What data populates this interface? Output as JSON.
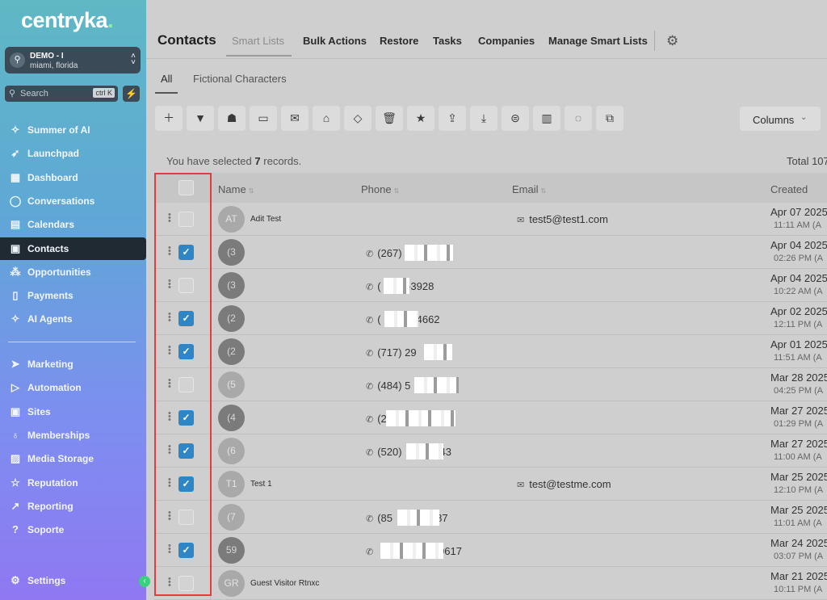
{
  "app": {
    "logo": "centryka",
    "logo_dot": "."
  },
  "account": {
    "name": "DEMO - I",
    "location": "miami, florida"
  },
  "search": {
    "placeholder": "Search",
    "shortcut": "ctrl K"
  },
  "sidebar": {
    "items": [
      {
        "label": "Summer of AI",
        "icon": "sparkle-icon"
      },
      {
        "label": "Launchpad",
        "icon": "rocket-icon"
      },
      {
        "label": "Dashboard",
        "icon": "grid-icon"
      },
      {
        "label": "Conversations",
        "icon": "chat-icon"
      },
      {
        "label": "Calendars",
        "icon": "calendar-icon"
      },
      {
        "label": "Contacts",
        "icon": "contacts-icon",
        "active": true
      },
      {
        "label": "Opportunities",
        "icon": "network-icon"
      },
      {
        "label": "Payments",
        "icon": "receipt-icon"
      },
      {
        "label": "AI Agents",
        "icon": "sparkle-icon"
      }
    ],
    "items2": [
      {
        "label": "Marketing",
        "icon": "send-icon"
      },
      {
        "label": "Automation",
        "icon": "play-icon"
      },
      {
        "label": "Sites",
        "icon": "browser-icon"
      },
      {
        "label": "Memberships",
        "icon": "badge-icon"
      },
      {
        "label": "Media Storage",
        "icon": "image-icon"
      },
      {
        "label": "Reputation",
        "icon": "star-icon"
      },
      {
        "label": "Reporting",
        "icon": "chart-icon"
      },
      {
        "label": "Soporte",
        "icon": "help-icon"
      }
    ],
    "settings": "Settings"
  },
  "header": {
    "title": "Contacts",
    "tabs": [
      "Smart Lists",
      "Bulk Actions",
      "Restore",
      "Tasks",
      "Companies",
      "Manage Smart Lists"
    ]
  },
  "subtabs": [
    "All",
    "Fictional Characters"
  ],
  "toolbar": {
    "columns_label": "Columns"
  },
  "selection": {
    "prefix": "You have selected",
    "count": "7",
    "suffix": "records.",
    "total": "Total 107"
  },
  "table": {
    "columns": [
      "Name",
      "Phone",
      "Email",
      "Created"
    ],
    "rows": [
      {
        "checked": false,
        "avatar": "AT",
        "name": "Adit Test",
        "phone": "",
        "email": "test5@test1.com",
        "date": "Apr 07 2025",
        "time": "11:11 AM (A"
      },
      {
        "checked": true,
        "avatar": "(3",
        "name": "",
        "phone": "(267)",
        "email": "",
        "date": "Apr 04 2025",
        "time": "02:26 PM (A"
      },
      {
        "checked": false,
        "avatar": "(3",
        "name": "",
        "phone": "(       4-3928",
        "email": "",
        "date": "Apr 04 2025",
        "time": "10:22 AM (A"
      },
      {
        "checked": true,
        "avatar": "(2",
        "name": "",
        "phone": "(         5-4662",
        "email": "",
        "date": "Apr 02 2025",
        "time": "12:11 PM (A"
      },
      {
        "checked": true,
        "avatar": "(2",
        "name": "",
        "phone": "(717) 29",
        "email": "",
        "date": "Apr 01 2025",
        "time": "11:51 AM (A"
      },
      {
        "checked": false,
        "avatar": "(5",
        "name": "",
        "phone": "(484) 5",
        "email": "",
        "date": "Mar 28 2025",
        "time": "04:25 PM (A"
      },
      {
        "checked": true,
        "avatar": "(4",
        "name": "",
        "phone": "(267) 4",
        "email": "",
        "date": "Mar 27 2025",
        "time": "01:29 PM (A"
      },
      {
        "checked": true,
        "avatar": "(6",
        "name": "",
        "phone": "(520)             43",
        "email": "",
        "date": "Mar 27 2025",
        "time": "11:00 AM (A"
      },
      {
        "checked": true,
        "avatar": "T1",
        "name": "Test 1",
        "phone": "",
        "email": "test@testme.com",
        "date": "Mar 25 2025",
        "time": "12:10 PM (A"
      },
      {
        "checked": false,
        "avatar": "(7",
        "name": "",
        "phone": "(85               87",
        "email": "",
        "date": "Mar 25 2025",
        "time": "11:01 AM (A"
      },
      {
        "checked": true,
        "avatar": "59",
        "name": "",
        "phone": "                     9617",
        "email": "",
        "date": "Mar 24 2025",
        "time": "03:07 PM (A"
      },
      {
        "checked": false,
        "avatar": "GR",
        "name": "Guest Visitor Rtnxc",
        "phone": "",
        "email": "",
        "date": "Mar 21 2025",
        "time": "10:11 PM (A"
      }
    ]
  }
}
